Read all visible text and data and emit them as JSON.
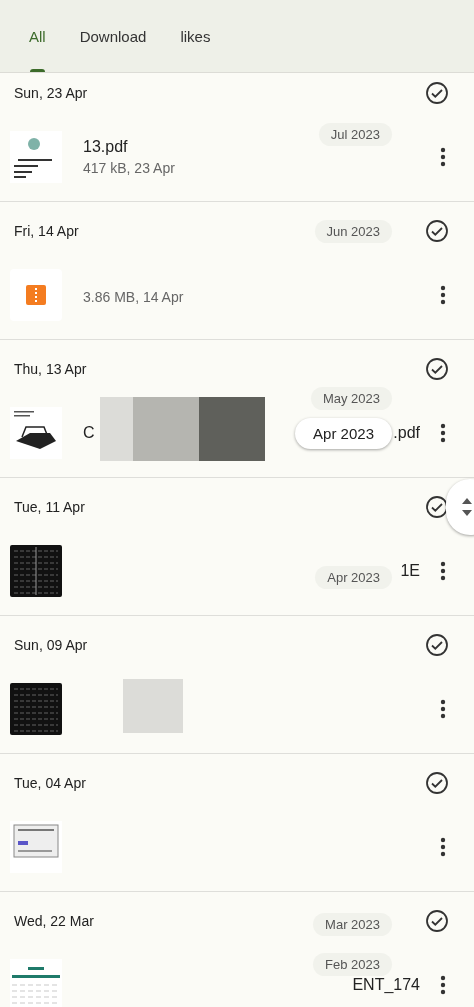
{
  "tabs": [
    {
      "label": "All",
      "selected": true
    },
    {
      "label": "Download",
      "selected": false
    },
    {
      "label": "likes",
      "selected": false
    }
  ],
  "sections": [
    {
      "date": "Sun, 23 Apr",
      "checked": true,
      "file": {
        "kind": "document",
        "name": "13.pdf",
        "meta": "417 kB, 23 Apr"
      }
    },
    {
      "date": "Fri, 14 Apr",
      "checked": true,
      "file": {
        "kind": "archive",
        "meta": "3.86 MB, 14 Apr"
      }
    },
    {
      "date": "Thu, 13 Apr",
      "checked": true,
      "file": {
        "kind": "drawing",
        "name": "C",
        "name_end": ".pdf",
        "redaction": {
          "kind": "dark"
        }
      }
    },
    {
      "date": "Tue, 11 Apr",
      "checked": true,
      "file": {
        "kind": "table",
        "name_end": "1E"
      }
    },
    {
      "date": "Sun, 09 Apr",
      "checked": true,
      "file": {
        "kind": "dark",
        "redaction": {
          "kind": "light"
        }
      }
    },
    {
      "date": "Tue, 04 Apr",
      "checked": true,
      "file": {
        "kind": "form"
      }
    },
    {
      "date": "Wed, 22 Mar",
      "checked": true,
      "file": {
        "kind": "sheet",
        "name_end": "ENT_174"
      }
    }
  ],
  "scrubber": {
    "labels": [
      {
        "text": "Jul 2023",
        "selected": false
      },
      {
        "text": "Jun 2023",
        "selected": false
      },
      {
        "text": "May 2023",
        "selected": false
      },
      {
        "text": "Apr 2023",
        "selected": true
      },
      {
        "text": "Apr 2023",
        "selected": false
      },
      {
        "text": "Mar 2023",
        "selected": false
      },
      {
        "text": "Feb 2023",
        "selected": false
      }
    ]
  }
}
